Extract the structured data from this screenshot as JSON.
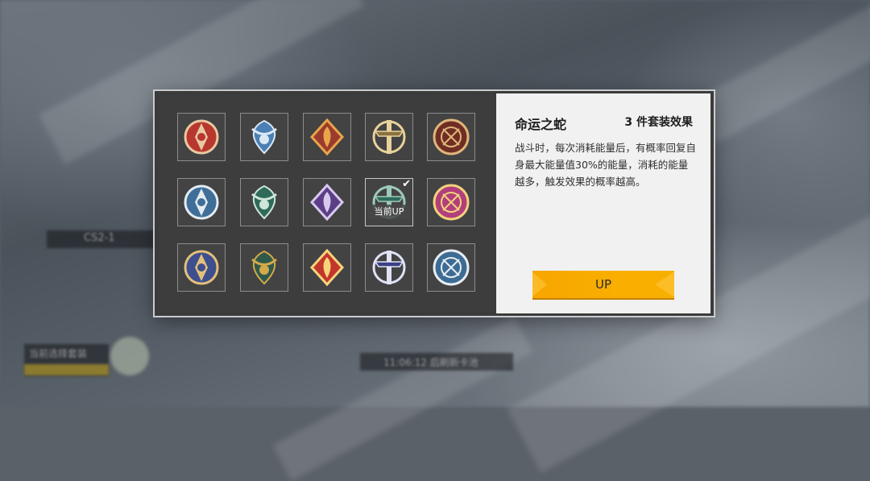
{
  "background": {
    "stage_label": "CS2-1",
    "bottom_left_label": "当前选择套装",
    "bottom_center_label": "11:06:12 后刷新卡池"
  },
  "set_panel": {
    "sets": [
      {
        "name": "set-1",
        "icon": "crimson-crest-icon",
        "color": "#b8372f",
        "accent": "#e9c9a3"
      },
      {
        "name": "set-2",
        "icon": "azure-wings-icon",
        "color": "#4b7fb5",
        "accent": "#dbe8f4"
      },
      {
        "name": "set-3",
        "icon": "flame-crest-icon",
        "color": "#9b3b2d",
        "accent": "#e9a54b"
      },
      {
        "name": "set-4",
        "icon": "golden-sword-icon",
        "color": "#8a7140",
        "accent": "#e8d29a"
      },
      {
        "name": "set-5",
        "icon": "ornate-shield-icon",
        "color": "#6f2e24",
        "accent": "#e0b57a"
      },
      {
        "name": "set-6",
        "icon": "white-beast-icon",
        "color": "#3f6f98",
        "accent": "#e4ecf2"
      },
      {
        "name": "set-7",
        "icon": "jade-ring-icon",
        "color": "#2f6b58",
        "accent": "#cfe6d9"
      },
      {
        "name": "set-8",
        "icon": "violet-dragon-icon",
        "color": "#5b3f86",
        "accent": "#d7c8ee"
      },
      {
        "name": "set-9",
        "icon": "serpent-icon",
        "color": "#2e6b5e",
        "accent": "#9ec9b8",
        "selected": true,
        "up_tag": "当前UP"
      },
      {
        "name": "set-10",
        "icon": "goblet-icon",
        "color": "#b23f7c",
        "accent": "#f2d27a"
      },
      {
        "name": "set-11",
        "icon": "sun-crest-icon",
        "color": "#3d4f8f",
        "accent": "#e4c07a"
      },
      {
        "name": "set-12",
        "icon": "spartan-helmet-icon",
        "color": "#2f5a4b",
        "accent": "#d4a94a"
      },
      {
        "name": "set-13",
        "icon": "sun-banner-icon",
        "color": "#c2362c",
        "accent": "#f6d57a"
      },
      {
        "name": "set-14",
        "icon": "moon-spear-icon",
        "color": "#3b3f86",
        "accent": "#dfe3f5"
      },
      {
        "name": "set-15",
        "icon": "temple-icon",
        "color": "#3d6b93",
        "accent": "#e6edf3"
      }
    ]
  },
  "info": {
    "set_name": "命运之蛇",
    "set_effect_label": "3 件套装效果",
    "description": "战斗时，每次消耗能量后，有概率回复自身最大能量值30%的能量，消耗的能量越多，触发效果的概率越高。",
    "up_button": "UP"
  }
}
